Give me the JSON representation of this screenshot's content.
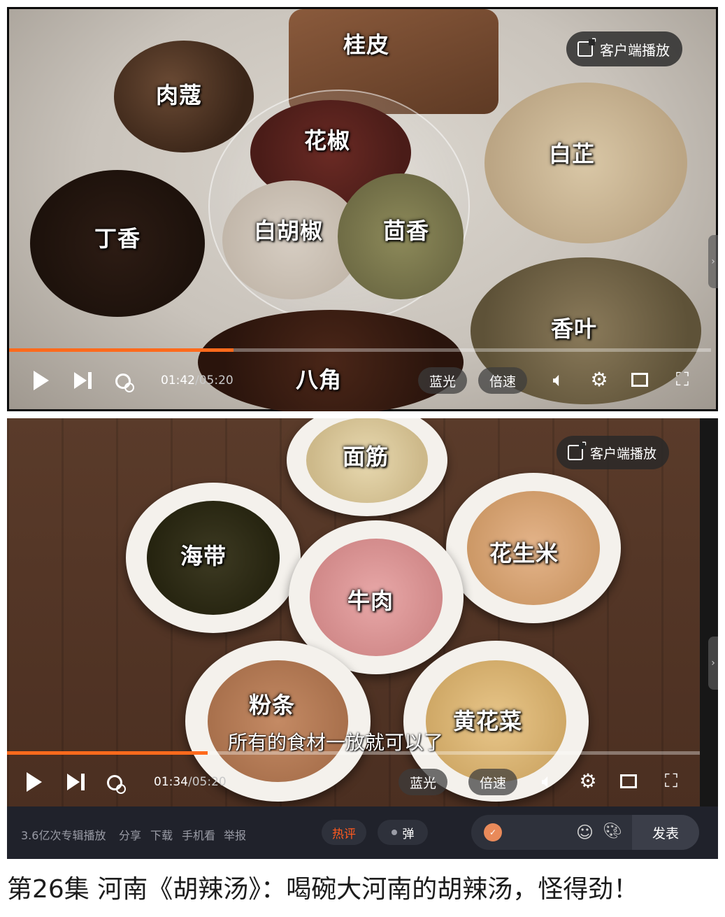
{
  "player_top": {
    "ingredients": {
      "rougou": "肉蔻",
      "guipi": "桂皮",
      "huajiao": "花椒",
      "baizhi": "白芷",
      "dingxiang": "丁香",
      "baihujiao": "白胡椒",
      "huixiang": "茴香",
      "xiangye": "香叶",
      "bajiao": "八角"
    },
    "client_play_label": "客户端播放",
    "progress_fraction": 0.32,
    "time_current": "01:42",
    "time_total": "/05:20",
    "quality_label": "蓝光",
    "speed_label": "倍速"
  },
  "player_bottom": {
    "ingredients": {
      "mianjin": "面筋",
      "haidai": "海带",
      "huashengmi": "花生米",
      "niurou": "牛肉",
      "fentiao": "粉条",
      "huanghuacai": "黄花菜"
    },
    "subtitle": "所有的食材一放就可以了",
    "client_play_label": "客户端播放",
    "progress_fraction": 0.29,
    "time_current": "01:34",
    "time_total": "/05:20",
    "quality_label": "蓝光",
    "speed_label": "倍速"
  },
  "info_bar": {
    "play_count": "3.6亿次专辑播放",
    "share": "分享",
    "download": "下载",
    "mobile": "手机看",
    "report": "举报",
    "hot_comments": "热评",
    "danmaku": "弹",
    "send": "发表"
  },
  "episode_title": "第26集 河南《胡辣汤》：喝碗大河南的胡辣汤，怪得劲！",
  "colors": {
    "progress": "#ff6a1c",
    "hot_comment": "#ff5a1f",
    "bar_bg": "#20222b"
  },
  "icons": {
    "play": "play-icon",
    "next": "next-icon",
    "loop": "loop-icon",
    "volume": "volume-icon",
    "settings": "gear-icon",
    "pip": "pip-icon",
    "fullscreen": "fullscreen-icon",
    "external": "external-link-icon",
    "emoji": "emoji-icon",
    "palette": "palette-icon"
  }
}
